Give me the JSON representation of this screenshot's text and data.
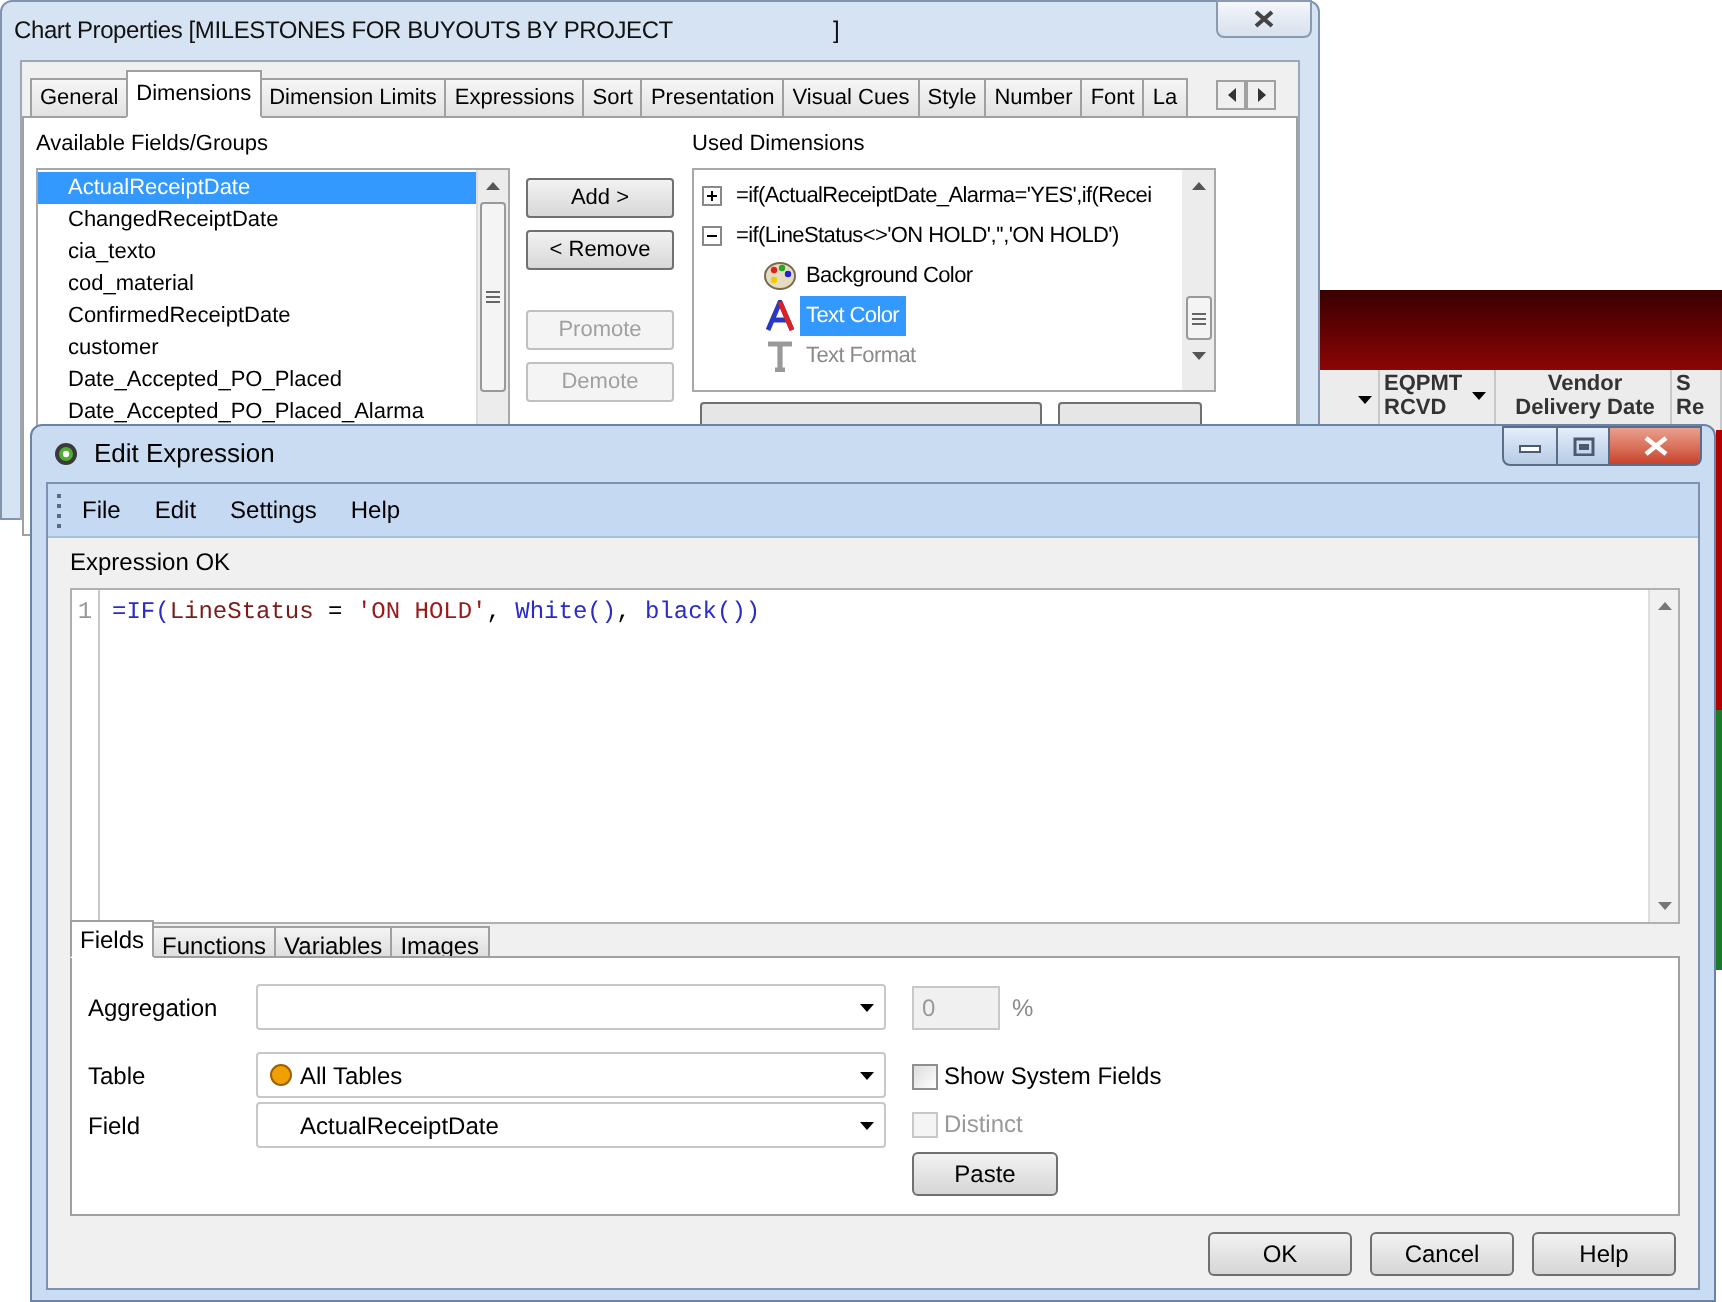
{
  "background_table": {
    "columns": [
      {
        "lines": [
          "EQPMT",
          "RCVD"
        ]
      },
      {
        "lines": [
          "Vendor",
          "Delivery Date"
        ]
      },
      {
        "lines": [
          "S",
          "Re"
        ]
      }
    ]
  },
  "chart_properties": {
    "title": "Chart Properties [MILESTONES FOR BUYOUTS BY PROJECT",
    "title_end": "]",
    "tabs": [
      {
        "label": "General",
        "selected": false
      },
      {
        "label": "Dimensions",
        "selected": true
      },
      {
        "label": "Dimension Limits",
        "selected": false
      },
      {
        "label": "Expressions",
        "selected": false
      },
      {
        "label": "Sort",
        "selected": false
      },
      {
        "label": "Presentation",
        "selected": false
      },
      {
        "label": "Visual Cues",
        "selected": false
      },
      {
        "label": "Style",
        "selected": false
      },
      {
        "label": "Number",
        "selected": false
      },
      {
        "label": "Font",
        "selected": false
      },
      {
        "label": "La",
        "selected": false
      }
    ],
    "available_label": "Available Fields/Groups",
    "available_fields": [
      {
        "label": "ActualReceiptDate",
        "selected": true
      },
      {
        "label": "ChangedReceiptDate",
        "selected": false
      },
      {
        "label": "cia_texto",
        "selected": false
      },
      {
        "label": "cod_material",
        "selected": false
      },
      {
        "label": "ConfirmedReceiptDate",
        "selected": false
      },
      {
        "label": "customer",
        "selected": false
      },
      {
        "label": "Date_Accepted_PO_Placed",
        "selected": false
      },
      {
        "label": "Date_Accepted_PO_Placed_Alarma",
        "selected": false
      }
    ],
    "buttons": [
      {
        "label": "Add >",
        "disabled": false
      },
      {
        "label": "< Remove",
        "disabled": false
      },
      {
        "label": "Promote",
        "disabled": true
      },
      {
        "label": "Demote",
        "disabled": true
      }
    ],
    "used_label": "Used Dimensions",
    "used_dimensions": [
      {
        "label": "=if(ActualReceiptDate_Alarma='YES',if(Recei",
        "expanded": false
      },
      {
        "label": "=if(LineStatus<>'ON HOLD','','ON HOLD')",
        "expanded": true,
        "children": [
          {
            "label": "Background Color",
            "kind": "palette",
            "selected": false,
            "disabled": false
          },
          {
            "label": "Text Color",
            "kind": "text_color",
            "selected": true,
            "disabled": false
          },
          {
            "label": "Text Format",
            "kind": "text_format",
            "selected": false,
            "disabled": true
          }
        ]
      }
    ]
  },
  "edit_expression": {
    "title": "Edit Expression",
    "menu": [
      "File",
      "Edit",
      "Settings",
      "Help"
    ],
    "status": "Expression OK",
    "code_lines": [
      {
        "number": "1",
        "tokens": [
          {
            "text": "=IF(",
            "kind": "function"
          },
          {
            "text": "LineStatus",
            "kind": "field"
          },
          {
            "text": " = ",
            "kind": "plain"
          },
          {
            "text": "'ON HOLD'",
            "kind": "string"
          },
          {
            "text": ", ",
            "kind": "plain"
          },
          {
            "text": "White()",
            "kind": "function"
          },
          {
            "text": ", ",
            "kind": "plain"
          },
          {
            "text": "black()",
            "kind": "function"
          },
          {
            "text": ")",
            "kind": "function"
          }
        ]
      }
    ],
    "tabs": [
      {
        "label": "Fields",
        "selected": true
      },
      {
        "label": "Functions",
        "selected": false
      },
      {
        "label": "Variables",
        "selected": false
      },
      {
        "label": "Images",
        "selected": false
      }
    ],
    "aggregation": {
      "label": "Aggregation"
    },
    "percent_field": {
      "value": "0",
      "disabled": true
    },
    "percent_sign": "%",
    "table": {
      "label": "Table",
      "value": "All Tables"
    },
    "field": {
      "label": "Field",
      "value": "ActualReceiptDate"
    },
    "checkboxes": [
      {
        "label": "Show System Fields",
        "checked": false,
        "disabled": false
      },
      {
        "label": "Distinct",
        "checked": false,
        "disabled": true
      }
    ],
    "paste_button": "Paste",
    "footer_buttons": [
      "OK",
      "Cancel",
      "Help"
    ]
  }
}
